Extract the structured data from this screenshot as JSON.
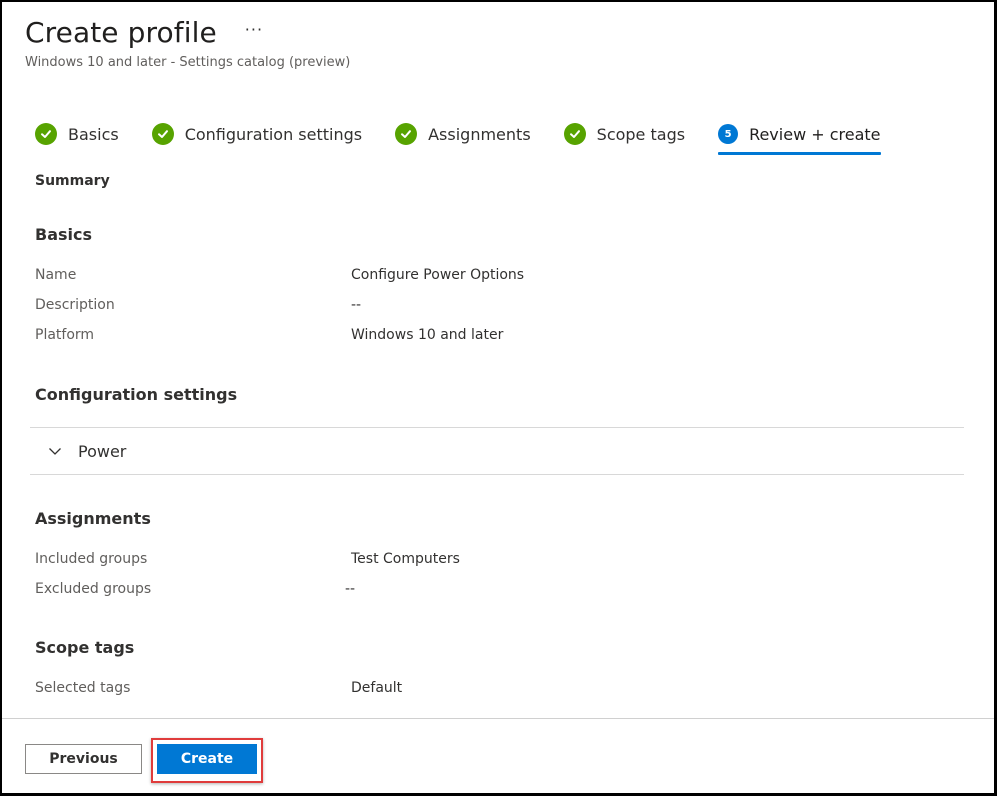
{
  "header": {
    "title": "Create profile",
    "more": "···",
    "subtitle": "Windows 10 and later - Settings catalog (preview)"
  },
  "steps": [
    {
      "label": "Basics",
      "status": "complete"
    },
    {
      "label": "Configuration settings",
      "status": "complete"
    },
    {
      "label": "Assignments",
      "status": "complete"
    },
    {
      "label": "Scope tags",
      "status": "complete"
    },
    {
      "label": "Review + create",
      "status": "active",
      "number": "5"
    }
  ],
  "summary": {
    "label": "Summary",
    "basics": {
      "title": "Basics",
      "rows": [
        {
          "key": "Name",
          "value": "Configure Power Options"
        },
        {
          "key": "Description",
          "value": "--"
        },
        {
          "key": "Platform",
          "value": "Windows 10 and later"
        }
      ]
    },
    "configuration": {
      "title": "Configuration settings",
      "accordion_label": "Power",
      "accordion_expanded": false
    },
    "assignments": {
      "title": "Assignments",
      "rows": [
        {
          "key": "Included groups",
          "value": "Test Computers"
        },
        {
          "key": "Excluded groups",
          "value": "--"
        }
      ]
    },
    "scope_tags": {
      "title": "Scope tags",
      "rows": [
        {
          "key": "Selected tags",
          "value": "Default"
        }
      ]
    }
  },
  "footer": {
    "previous_label": "Previous",
    "create_label": "Create"
  },
  "colors": {
    "complete": "#57a300",
    "active": "#0078d4",
    "primary_button": "#0078d4",
    "highlight": "#e03c3c"
  }
}
